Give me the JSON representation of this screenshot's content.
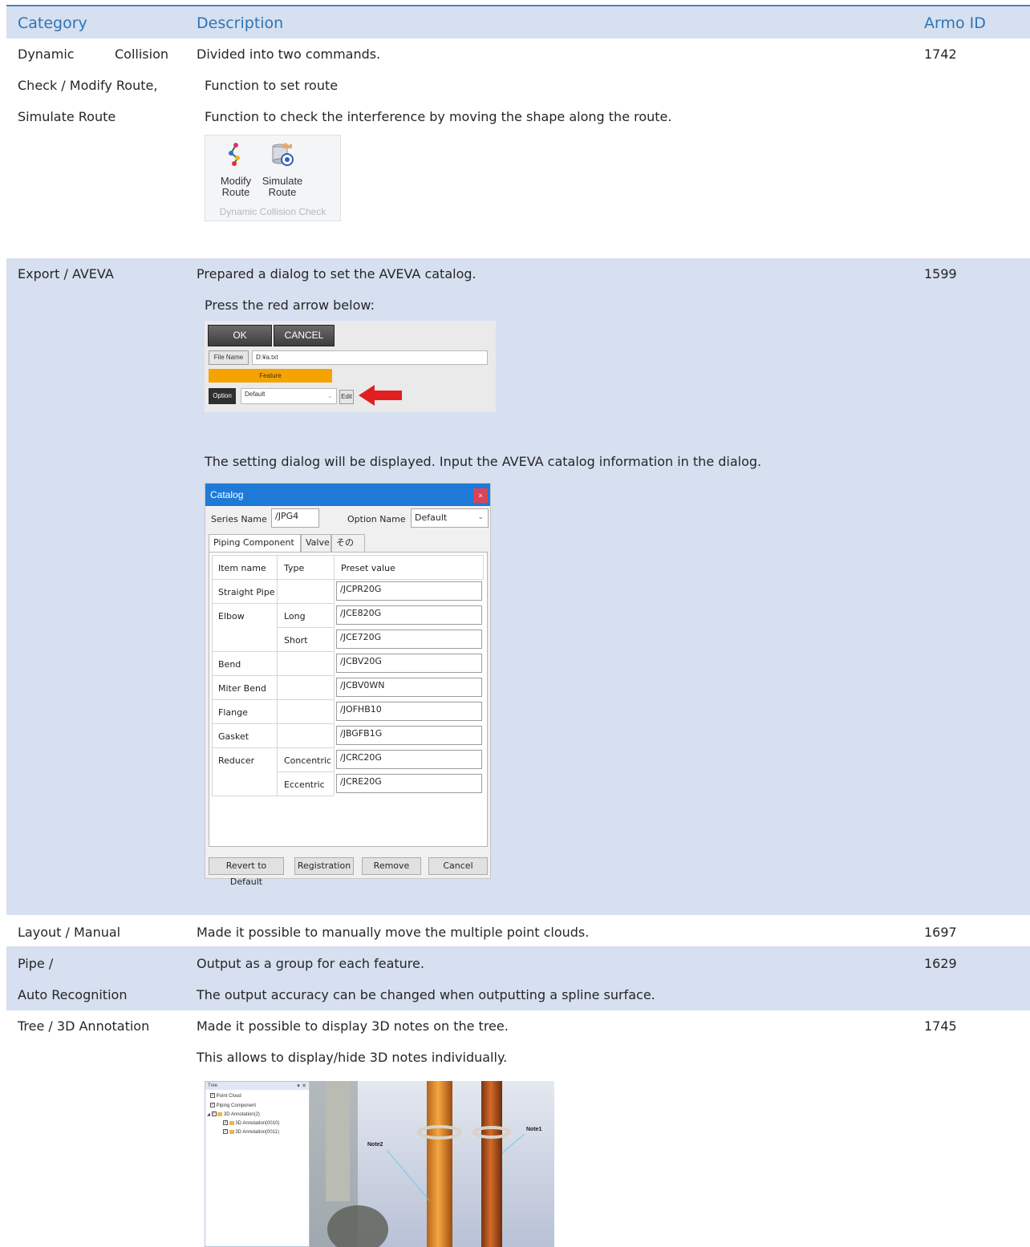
{
  "header": {
    "category": "Category",
    "description": "Description",
    "armo_id": "Armo ID"
  },
  "rows": [
    {
      "category_lines": [
        "Dynamic",
        "Collision",
        "Check / Modify Route,",
        "Simulate Route"
      ],
      "description": [
        "Divided into two commands.",
        "Function to set route",
        "Function to check the interference by moving the shape along the route."
      ],
      "armo_id": "1742",
      "ribbon": {
        "modify": [
          "Modify",
          "Route"
        ],
        "simulate": [
          "Simulate",
          "Route"
        ],
        "group": "Dynamic Collision Check"
      }
    },
    {
      "category": "Export / AVEVA",
      "description": [
        "Prepared a dialog to set the AVEVA catalog.",
        "Press the red arrow below:",
        "The setting dialog will be displayed. Input the AVEVA catalog information in the dialog."
      ],
      "armo_id": "1599",
      "export_dialog": {
        "ok": "OK",
        "cancel": "CANCEL",
        "file_name_label": "File Name",
        "file_name_value": "D:¥a.txt",
        "feature": "Feature",
        "option_label": "Option",
        "option_value": "Default",
        "edit": "Edit"
      },
      "catalog_dialog": {
        "title": "Catalog",
        "close": "×",
        "series_name_label": "Series Name",
        "series_name_value": "/JPG4",
        "option_name_label": "Option Name",
        "option_name_value": "Default",
        "tabs": [
          "Piping Component",
          "Valve",
          "その他"
        ],
        "columns": [
          "Item name",
          "Type",
          "Preset value"
        ],
        "items": [
          {
            "name": "Straight Pipe",
            "type": "",
            "value": "/JCPR20G"
          },
          {
            "name": "Elbow",
            "type": "Long",
            "value": "/JCE820G"
          },
          {
            "name": "",
            "type": "Short",
            "value": "/JCE720G"
          },
          {
            "name": "Bend",
            "type": "",
            "value": "/JCBV20G"
          },
          {
            "name": "Miter Bend",
            "type": "",
            "value": "/JCBV0WN"
          },
          {
            "name": "Flange",
            "type": "",
            "value": "/JOFHB10"
          },
          {
            "name": "Gasket",
            "type": "",
            "value": "/JBGFB1G"
          },
          {
            "name": "Reducer",
            "type": "Concentric",
            "value": "/JCRC20G"
          },
          {
            "name": "",
            "type": "Eccentric",
            "value": "/JCRE20G"
          }
        ],
        "buttons": [
          "Revert to Default",
          "Registration",
          "Remove",
          "Cancel"
        ]
      }
    },
    {
      "category": "Layout / Manual",
      "description": [
        "Made it possible to manually move the multiple point clouds."
      ],
      "armo_id": "1697"
    },
    {
      "category_lines": [
        "Pipe /",
        "Auto Recognition"
      ],
      "description": [
        "Output as a group for each feature.",
        "The output accuracy can be changed when outputting a spline surface."
      ],
      "armo_id": "1629"
    },
    {
      "category": "Tree / 3D Annotation",
      "description": [
        "Made it possible to display 3D notes on the tree.",
        "This allows to display/hide 3D notes individually."
      ],
      "armo_id": "1745",
      "tree": {
        "title": "Tree",
        "items": [
          "Point Cloud",
          "Piping Component",
          "3D Annotation(2)",
          "3D Annotation(0010)",
          "3D Annotation(0011)"
        ],
        "notes": [
          "Note1",
          "Note2"
        ]
      }
    }
  ],
  "colors": {
    "header_text": "#2e74b5",
    "band": "#d6e0f0",
    "rule": "#4f81bd",
    "arrow": "#e02020",
    "feature": "#f5a300"
  }
}
